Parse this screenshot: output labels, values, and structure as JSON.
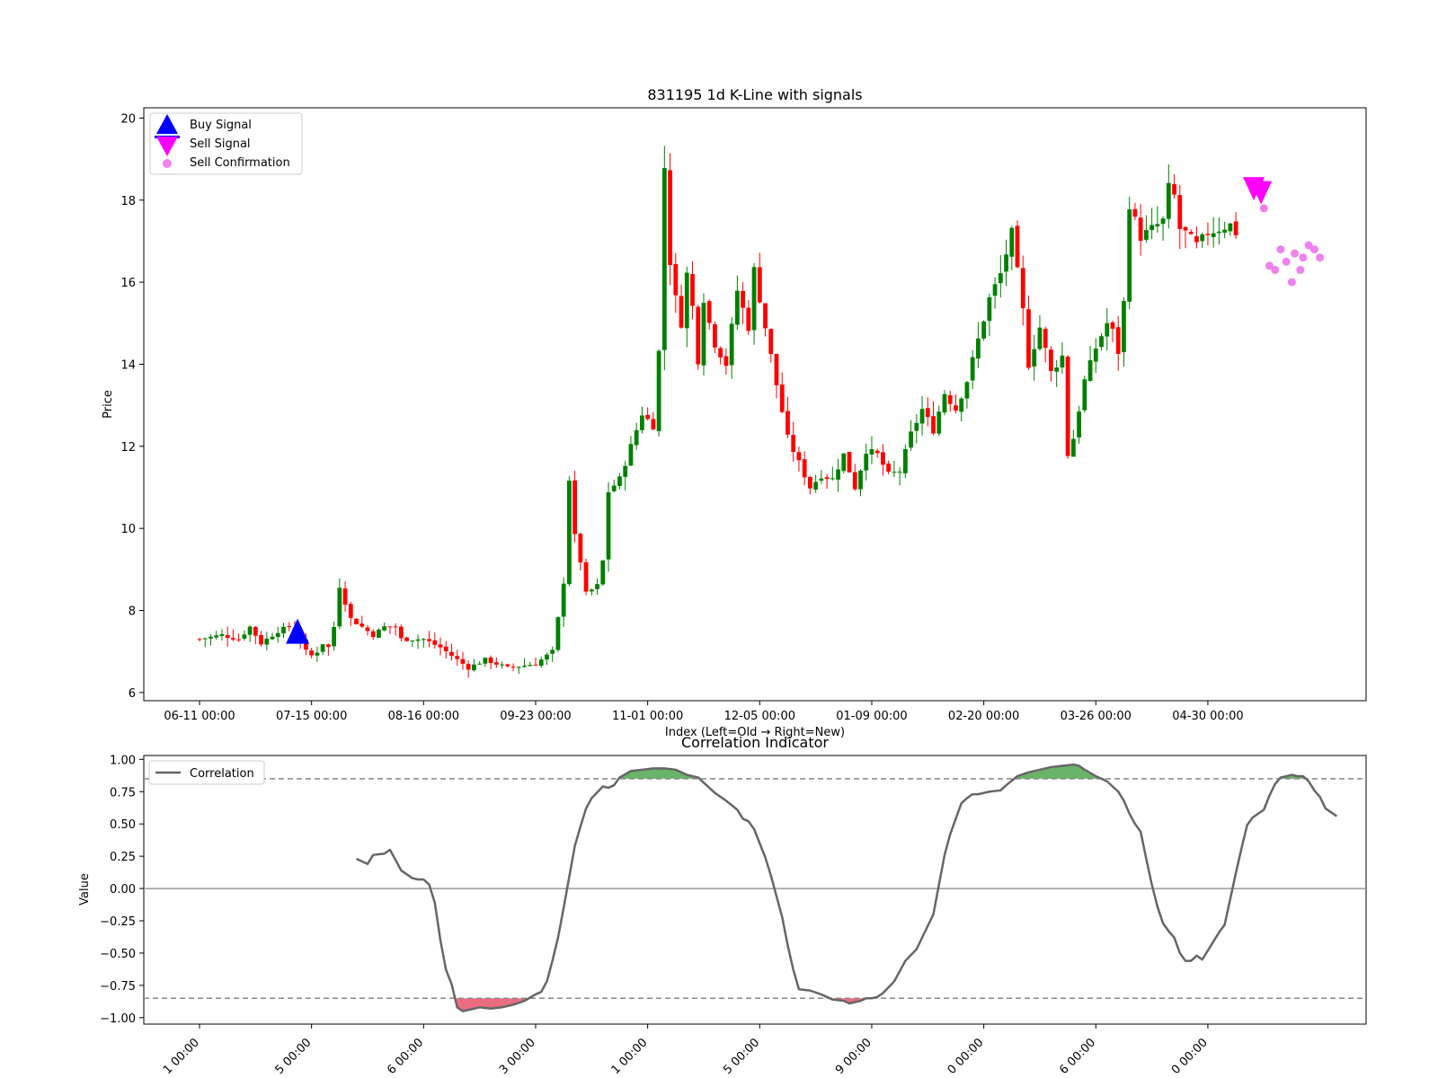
{
  "chart_data": [
    {
      "type": "candlestick",
      "title": "831195 1d K-Line with signals",
      "xlabel": "Index (Left=Old → Right=New)",
      "ylabel": "Price",
      "ylim": [
        5.8,
        20.25
      ],
      "yticks": [
        6,
        8,
        10,
        12,
        14,
        16,
        18,
        20
      ],
      "xtick_labels": [
        "06-11 00:00",
        "07-15 00:00",
        "08-16 00:00",
        "09-23 00:00",
        "11-01 00:00",
        "12-05 00:00",
        "01-09 00:00",
        "02-20 00:00",
        "03-26 00:00",
        "04-30 00:00"
      ],
      "xtick_index": [
        0,
        20,
        40,
        60,
        80,
        100,
        120,
        140,
        160,
        180
      ],
      "grid": false,
      "legend_position": "upper-left",
      "legend": [
        "Buy Signal",
        "Sell Signal",
        "Sell Confirmation"
      ],
      "colors": {
        "up": "#008000",
        "down": "#ff0000",
        "buy": "#0000ff",
        "sell": "#ff00ff",
        "confirm": "#ee82ee"
      },
      "close_path": [
        [
          0,
          7.3
        ],
        [
          4,
          7.4
        ],
        [
          7,
          7.3
        ],
        [
          9,
          7.6
        ],
        [
          11,
          7.2
        ],
        [
          14,
          7.5
        ],
        [
          16,
          7.6
        ],
        [
          18,
          7.3
        ],
        [
          19,
          7.0
        ],
        [
          20,
          6.9
        ],
        [
          21,
          7.0
        ],
        [
          22,
          7.2
        ],
        [
          23,
          7.1
        ],
        [
          24,
          7.6
        ],
        [
          25,
          8.6
        ],
        [
          27,
          7.8
        ],
        [
          29,
          7.6
        ],
        [
          31,
          7.4
        ],
        [
          33,
          7.6
        ],
        [
          35,
          7.6
        ],
        [
          36,
          7.3
        ],
        [
          40,
          7.3
        ],
        [
          43,
          7.1
        ],
        [
          46,
          6.8
        ],
        [
          48,
          6.6
        ],
        [
          51,
          6.8
        ],
        [
          55,
          6.6
        ],
        [
          60,
          6.7
        ],
        [
          63,
          7.0
        ],
        [
          64,
          7.8
        ],
        [
          65,
          8.7
        ],
        [
          66,
          11.2
        ],
        [
          67,
          9.8
        ],
        [
          68,
          9.2
        ],
        [
          69,
          8.4
        ],
        [
          71,
          8.6
        ],
        [
          72,
          9.2
        ],
        [
          73,
          10.9
        ],
        [
          75,
          11.2
        ],
        [
          77,
          12.0
        ],
        [
          79,
          12.8
        ],
        [
          81,
          12.5
        ],
        [
          82,
          14.3
        ],
        [
          83,
          18.8
        ],
        [
          84,
          16.5
        ],
        [
          85,
          15.6
        ],
        [
          86,
          15.0
        ],
        [
          87,
          16.2
        ],
        [
          88,
          15.4
        ],
        [
          89,
          14.1
        ],
        [
          90,
          15.6
        ],
        [
          91,
          15.0
        ],
        [
          92,
          14.5
        ],
        [
          94,
          14.0
        ],
        [
          96,
          15.8
        ],
        [
          98,
          14.9
        ],
        [
          99,
          16.3
        ],
        [
          100,
          15.6
        ],
        [
          101,
          14.9
        ],
        [
          103,
          13.5
        ],
        [
          105,
          12.2
        ],
        [
          107,
          11.6
        ],
        [
          109,
          11.0
        ],
        [
          111,
          11.3
        ],
        [
          113,
          11.2
        ],
        [
          115,
          11.8
        ],
        [
          117,
          11.0
        ],
        [
          119,
          11.9
        ],
        [
          121,
          11.8
        ],
        [
          123,
          11.3
        ],
        [
          125,
          11.4
        ],
        [
          127,
          12.3
        ],
        [
          129,
          12.9
        ],
        [
          131,
          12.4
        ],
        [
          133,
          13.3
        ],
        [
          135,
          12.9
        ],
        [
          137,
          13.6
        ],
        [
          139,
          14.6
        ],
        [
          141,
          15.6
        ],
        [
          143,
          16.2
        ],
        [
          145,
          17.2
        ],
        [
          147,
          15.3
        ],
        [
          148,
          14.0
        ],
        [
          150,
          14.9
        ],
        [
          152,
          13.8
        ],
        [
          154,
          14.2
        ],
        [
          155,
          11.8
        ],
        [
          156,
          12.2
        ],
        [
          158,
          13.6
        ],
        [
          160,
          14.4
        ],
        [
          162,
          15.0
        ],
        [
          163,
          14.8
        ],
        [
          164,
          14.3
        ],
        [
          165,
          15.5
        ],
        [
          166,
          17.9
        ],
        [
          168,
          17.1
        ],
        [
          170,
          17.3
        ],
        [
          172,
          17.5
        ],
        [
          173,
          18.3
        ],
        [
          174,
          18.1
        ],
        [
          175,
          17.3
        ],
        [
          176,
          17.2
        ],
        [
          178,
          16.9
        ],
        [
          180,
          17.2
        ],
        [
          182,
          17.3
        ],
        [
          184,
          17.4
        ],
        [
          185,
          17.2
        ]
      ],
      "buy_signals": [
        {
          "index": 17.5,
          "price": 7.45
        }
      ],
      "sell_signals": [
        {
          "index": 189.5,
          "price": 18.2
        },
        {
          "index": 188.2,
          "price": 18.3
        }
      ],
      "sell_confirmations": [
        {
          "index": 190,
          "price": 17.8
        },
        {
          "index": 191,
          "price": 16.4
        },
        {
          "index": 192,
          "price": 16.3
        },
        {
          "index": 193,
          "price": 16.8
        },
        {
          "index": 194,
          "price": 16.5
        },
        {
          "index": 195,
          "price": 16.0
        },
        {
          "index": 195.5,
          "price": 16.7
        },
        {
          "index": 196.5,
          "price": 16.3
        },
        {
          "index": 197,
          "price": 16.6
        },
        {
          "index": 198,
          "price": 16.9
        },
        {
          "index": 199,
          "price": 16.8
        },
        {
          "index": 200,
          "price": 16.6
        }
      ]
    },
    {
      "type": "line",
      "title": "Correlation Indicator",
      "ylabel": "Value",
      "ylim": [
        -1.05,
        1.03
      ],
      "yticks": [
        -1.0,
        -0.75,
        -0.5,
        -0.25,
        0.0,
        0.25,
        0.5,
        0.75,
        1.0
      ],
      "ytick_labels": [
        "−1.00",
        "−0.75",
        "−0.50",
        "−0.25",
        "0.00",
        "0.25",
        "0.50",
        "0.75",
        "1.00"
      ],
      "xtick_labels": [
        "1 00:00",
        "5 00:00",
        "6 00:00",
        "3 00:00",
        "1 00:00",
        "5 00:00",
        "9 00:00",
        "0 00:00",
        "6 00:00",
        "0 00:00"
      ],
      "xtick_index": [
        0,
        20,
        40,
        60,
        80,
        100,
        120,
        140,
        160,
        180
      ],
      "thresholds": [
        0.85,
        -0.85
      ],
      "zero_line": 0.0,
      "legend_position": "upper-left",
      "series": [
        {
          "name": "Correlation",
          "color": "#666666",
          "points": [
            [
              28,
              0.23
            ],
            [
              30,
              0.19
            ],
            [
              31,
              0.26
            ],
            [
              33,
              0.27
            ],
            [
              34,
              0.3
            ],
            [
              35,
              0.22
            ],
            [
              36,
              0.14
            ],
            [
              38,
              0.08
            ],
            [
              39,
              0.07
            ],
            [
              40,
              0.07
            ],
            [
              41,
              0.03
            ],
            [
              42,
              -0.11
            ],
            [
              43,
              -0.4
            ],
            [
              44,
              -0.63
            ],
            [
              45,
              -0.74
            ],
            [
              46,
              -0.92
            ],
            [
              47,
              -0.95
            ],
            [
              48,
              -0.94
            ],
            [
              49,
              -0.93
            ],
            [
              50,
              -0.92
            ],
            [
              52,
              -0.93
            ],
            [
              54,
              -0.92
            ],
            [
              56,
              -0.9
            ],
            [
              58,
              -0.87
            ],
            [
              60,
              -0.82
            ],
            [
              61,
              -0.8
            ],
            [
              62,
              -0.72
            ],
            [
              63,
              -0.56
            ],
            [
              64,
              -0.38
            ],
            [
              65,
              -0.15
            ],
            [
              66,
              0.09
            ],
            [
              67,
              0.33
            ],
            [
              68,
              0.48
            ],
            [
              69,
              0.62
            ],
            [
              70,
              0.7
            ],
            [
              72,
              0.79
            ],
            [
              73,
              0.78
            ],
            [
              74,
              0.8
            ],
            [
              75,
              0.86
            ],
            [
              77,
              0.91
            ],
            [
              79,
              0.92
            ],
            [
              81,
              0.93
            ],
            [
              83,
              0.93
            ],
            [
              85,
              0.92
            ],
            [
              86,
              0.9
            ],
            [
              87,
              0.88
            ],
            [
              89,
              0.86
            ],
            [
              90,
              0.82
            ],
            [
              92,
              0.74
            ],
            [
              94,
              0.68
            ],
            [
              96,
              0.61
            ],
            [
              97,
              0.54
            ],
            [
              98,
              0.52
            ],
            [
              99,
              0.46
            ],
            [
              100,
              0.35
            ],
            [
              101,
              0.24
            ],
            [
              102,
              0.1
            ],
            [
              103,
              -0.06
            ],
            [
              104,
              -0.22
            ],
            [
              105,
              -0.44
            ],
            [
              106,
              -0.63
            ],
            [
              107,
              -0.78
            ],
            [
              109,
              -0.79
            ],
            [
              111,
              -0.82
            ],
            [
              113,
              -0.86
            ],
            [
              115,
              -0.87
            ],
            [
              116,
              -0.89
            ],
            [
              117,
              -0.88
            ],
            [
              118,
              -0.87
            ],
            [
              119,
              -0.85
            ],
            [
              120,
              -0.85
            ],
            [
              121,
              -0.84
            ],
            [
              122,
              -0.81
            ],
            [
              124,
              -0.72
            ],
            [
              126,
              -0.56
            ],
            [
              128,
              -0.47
            ],
            [
              130,
              -0.29
            ],
            [
              131,
              -0.2
            ],
            [
              132,
              0.03
            ],
            [
              133,
              0.26
            ],
            [
              134,
              0.42
            ],
            [
              135,
              0.54
            ],
            [
              136,
              0.66
            ],
            [
              137,
              0.7
            ],
            [
              138,
              0.73
            ],
            [
              139,
              0.73
            ],
            [
              140,
              0.74
            ],
            [
              141,
              0.75
            ],
            [
              143,
              0.76
            ],
            [
              144,
              0.8
            ],
            [
              146,
              0.87
            ],
            [
              148,
              0.9
            ],
            [
              150,
              0.92
            ],
            [
              152,
              0.94
            ],
            [
              154,
              0.95
            ],
            [
              156,
              0.96
            ],
            [
              157,
              0.95
            ],
            [
              158,
              0.92
            ],
            [
              160,
              0.87
            ],
            [
              162,
              0.83
            ],
            [
              164,
              0.75
            ],
            [
              165,
              0.68
            ],
            [
              166,
              0.58
            ],
            [
              167,
              0.5
            ],
            [
              168,
              0.44
            ],
            [
              169,
              0.23
            ],
            [
              170,
              0.03
            ],
            [
              171,
              -0.14
            ],
            [
              172,
              -0.27
            ],
            [
              173,
              -0.33
            ],
            [
              174,
              -0.38
            ],
            [
              175,
              -0.5
            ],
            [
              176,
              -0.56
            ],
            [
              177,
              -0.56
            ],
            [
              178,
              -0.52
            ],
            [
              179,
              -0.55
            ],
            [
              180,
              -0.48
            ],
            [
              182,
              -0.34
            ],
            [
              183,
              -0.28
            ],
            [
              184,
              -0.08
            ],
            [
              185,
              0.12
            ],
            [
              186,
              0.31
            ],
            [
              187,
              0.49
            ],
            [
              188,
              0.55
            ],
            [
              190,
              0.61
            ],
            [
              191,
              0.72
            ],
            [
              192,
              0.81
            ],
            [
              193,
              0.86
            ],
            [
              195,
              0.88
            ],
            [
              196,
              0.87
            ],
            [
              197,
              0.87
            ],
            [
              198,
              0.83
            ],
            [
              199,
              0.76
            ],
            [
              200,
              0.71
            ],
            [
              201,
              0.62
            ],
            [
              203,
              0.56
            ]
          ]
        }
      ]
    }
  ]
}
